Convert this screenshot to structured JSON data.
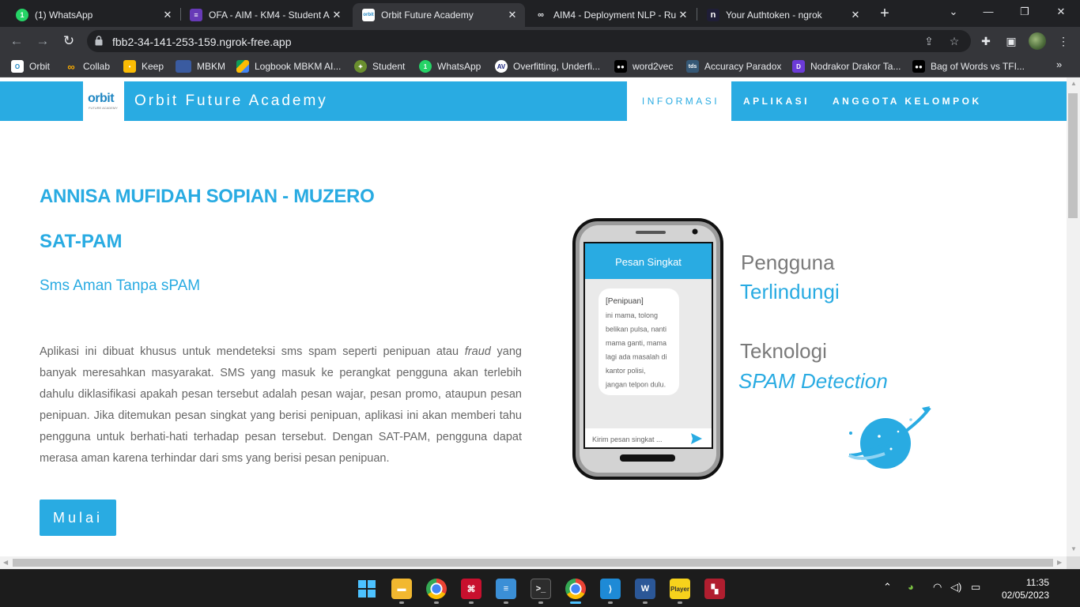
{
  "browser": {
    "tabs": [
      {
        "title": "(1) WhatsApp",
        "icon": "whatsapp-icon",
        "active": false
      },
      {
        "title": "OFA - AIM - KM4 - Student A",
        "icon": "form-icon",
        "active": false
      },
      {
        "title": "Orbit Future Academy",
        "icon": "orbit-icon",
        "active": true
      },
      {
        "title": "AIM4 - Deployment NLP - Ru",
        "icon": "colab-icon",
        "active": false
      },
      {
        "title": "Your Authtoken - ngrok",
        "icon": "ngrok-icon",
        "active": false
      }
    ],
    "url": "fbb2-34-141-253-159.ngrok-free.app",
    "bookmarks": [
      {
        "label": "Orbit",
        "icon": "orbit-icon"
      },
      {
        "label": "Collab",
        "icon": "colab-icon"
      },
      {
        "label": "Keep",
        "icon": "keep-icon"
      },
      {
        "label": "MBKM",
        "icon": "mbkm-icon"
      },
      {
        "label": "Logbook MBKM AI...",
        "icon": "drive-icon"
      },
      {
        "label": "Student",
        "icon": "student-icon"
      },
      {
        "label": "WhatsApp",
        "icon": "whatsapp-icon"
      },
      {
        "label": "Overfitting, Underfi...",
        "icon": "av-icon"
      },
      {
        "label": "word2vec",
        "icon": "medium-icon"
      },
      {
        "label": "Accuracy Paradox",
        "icon": "tds-icon"
      },
      {
        "label": "Nodrakor Drakor Ta...",
        "icon": "d-icon"
      },
      {
        "label": "Bag of Words vs TFI...",
        "icon": "medium-icon"
      }
    ],
    "bookmarks_more": "»"
  },
  "site": {
    "logo_text": "orbit",
    "logo_subtext": "FUTURE ACADEMY",
    "brand": "Orbit Future Academy",
    "nav": [
      "INFORMASI",
      "APLIKASI",
      "ANGGOTA KELOMPOK"
    ],
    "active_nav": "INFORMASI"
  },
  "hero": {
    "name": "ANNISA MUFIDAH SOPIAN - MUZERO",
    "app_name": "SAT-PAM",
    "tagline": "Sms Aman Tanpa sPAM",
    "description_part1": "Aplikasi ini dibuat khusus untuk mendeteksi sms spam seperti penipuan atau ",
    "description_italic": "fraud",
    "description_part2": " yang banyak meresahkan masyarakat. SMS yang masuk ke perangkat pengguna akan terlebih dahulu diklasifikasi apakah pesan tersebut adalah pesan wajar, pesan promo, ataupun pesan penipuan. Jika ditemukan pesan singkat yang berisi penipuan, aplikasi ini akan memberi tahu pengguna untuk berhati-hati terhadap pesan tersebut. Dengan SAT-PAM, pengguna dapat merasa aman karena terhindar dari sms yang berisi pesan penipuan.",
    "button": "Mulai"
  },
  "illustration": {
    "phone_header": "Pesan Singkat",
    "sender": "[Penipuan]",
    "message_lines": [
      "ini mama, tolong",
      "belikan pulsa, nanti",
      "mama ganti, mama",
      "lagi ada masalah di",
      "kantor polisi,",
      "jangan telpon dulu."
    ],
    "input_placeholder": "Kirim pesan singkat ...",
    "text1": "Pengguna",
    "text2": "Terlindungi",
    "text3": "Teknologi",
    "text4": "SPAM Detection",
    "colors": {
      "accent": "#29abe2",
      "gray_text": "#7a7a7a",
      "phone_border": "#111111"
    }
  },
  "taskbar": {
    "apps": [
      "start-icon",
      "file-explorer-icon",
      "chrome-icon",
      "acrobat-icon",
      "notepad-icon",
      "terminal-icon",
      "chrome-profile-icon",
      "vscode-icon",
      "word-icon",
      "potplayer-icon",
      "mendeley-icon"
    ],
    "time": "11:35",
    "date": "02/05/2023"
  }
}
